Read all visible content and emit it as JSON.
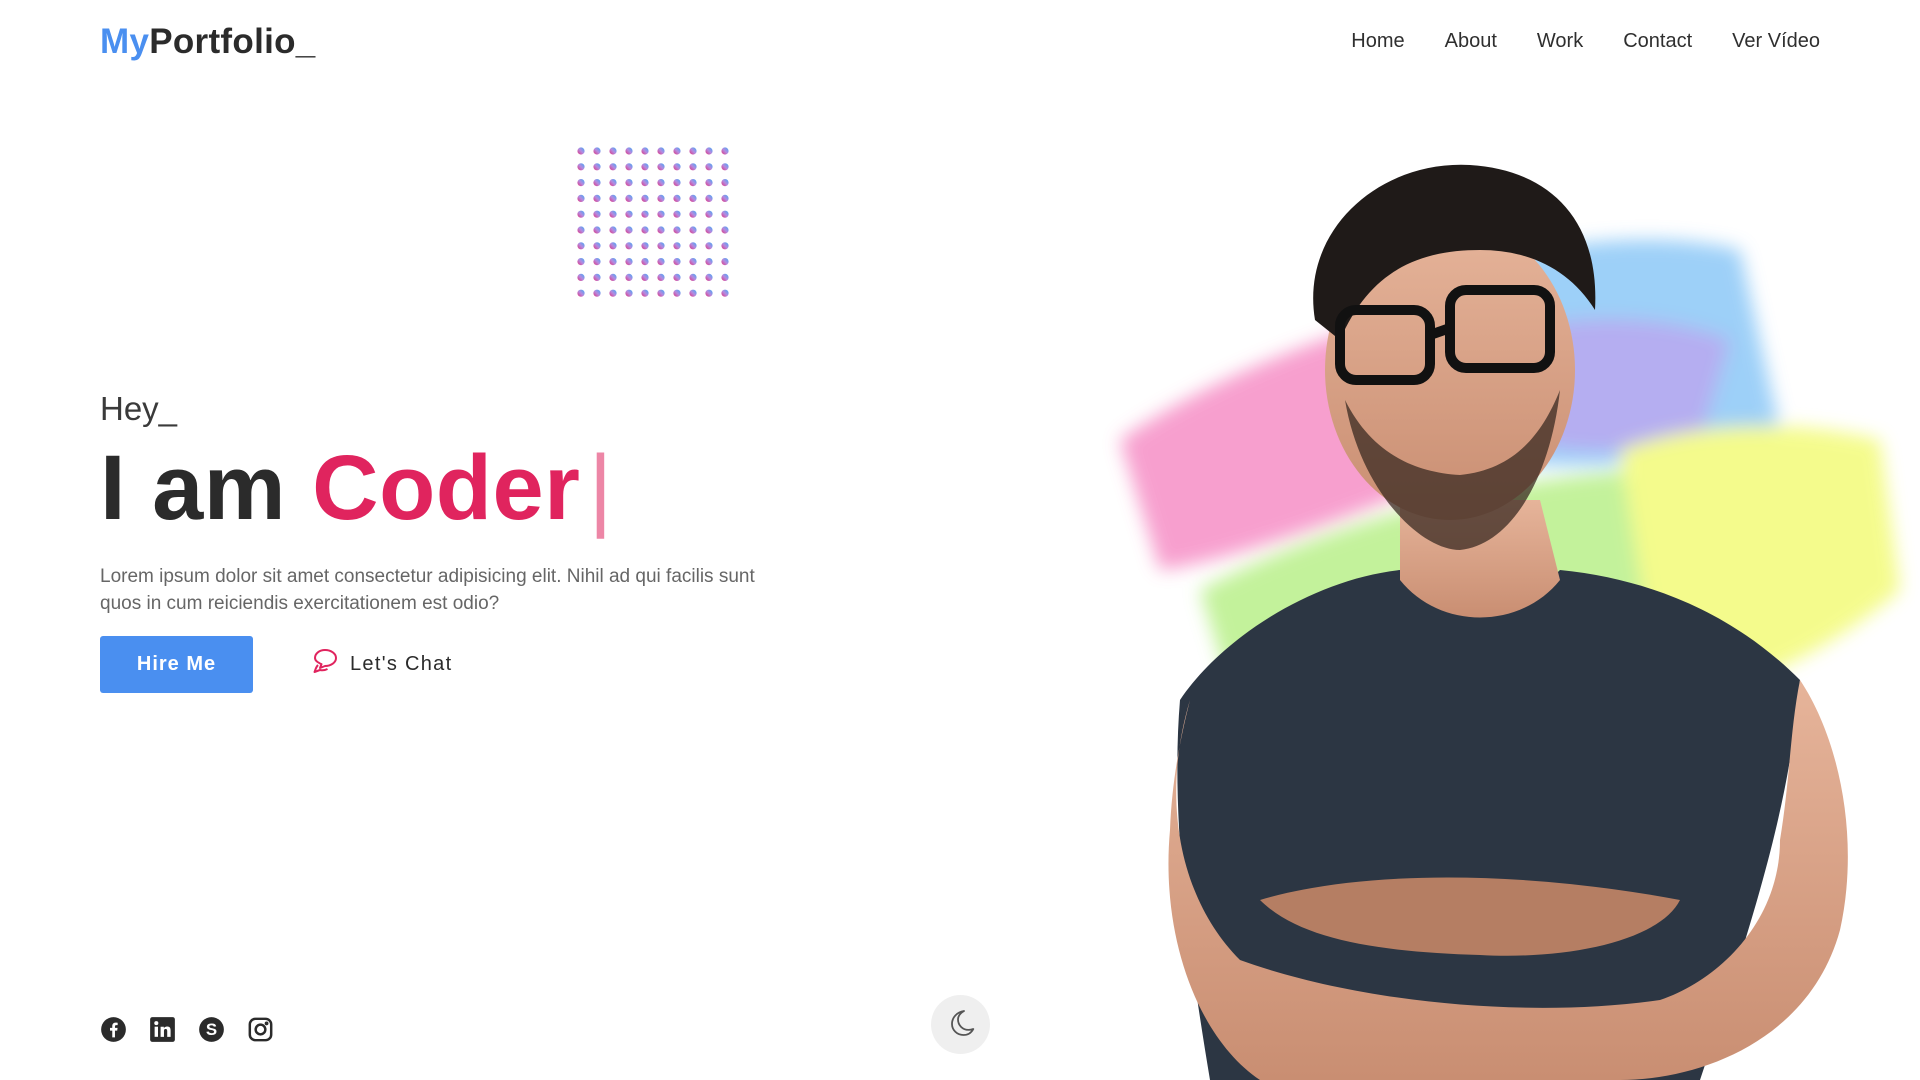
{
  "header": {
    "logo_accent": "My",
    "logo_rest": "Portfolio_",
    "nav": [
      "Home",
      "About",
      "Work",
      "Contact",
      "Ver Vídeo"
    ]
  },
  "hero": {
    "greeting": "Hey_",
    "headline_lead": "I am",
    "headline_role": "Coder",
    "cursor": "|",
    "description": "Lorem ipsum dolor sit amet consectetur adipisicing elit. Nihil ad qui facilis sunt quos in cum reiciendis exercitationem est odio?",
    "hire_label": "Hire Me",
    "chat_label": "Let's Chat"
  },
  "socials": [
    "facebook-icon",
    "linkedin-icon",
    "skype-icon",
    "instagram-icon"
  ],
  "colors": {
    "accent_blue": "#4a8ff0",
    "accent_pink": "#e0245e",
    "text_dark": "#2b2b2b",
    "toggle_bg": "#efefef"
  }
}
